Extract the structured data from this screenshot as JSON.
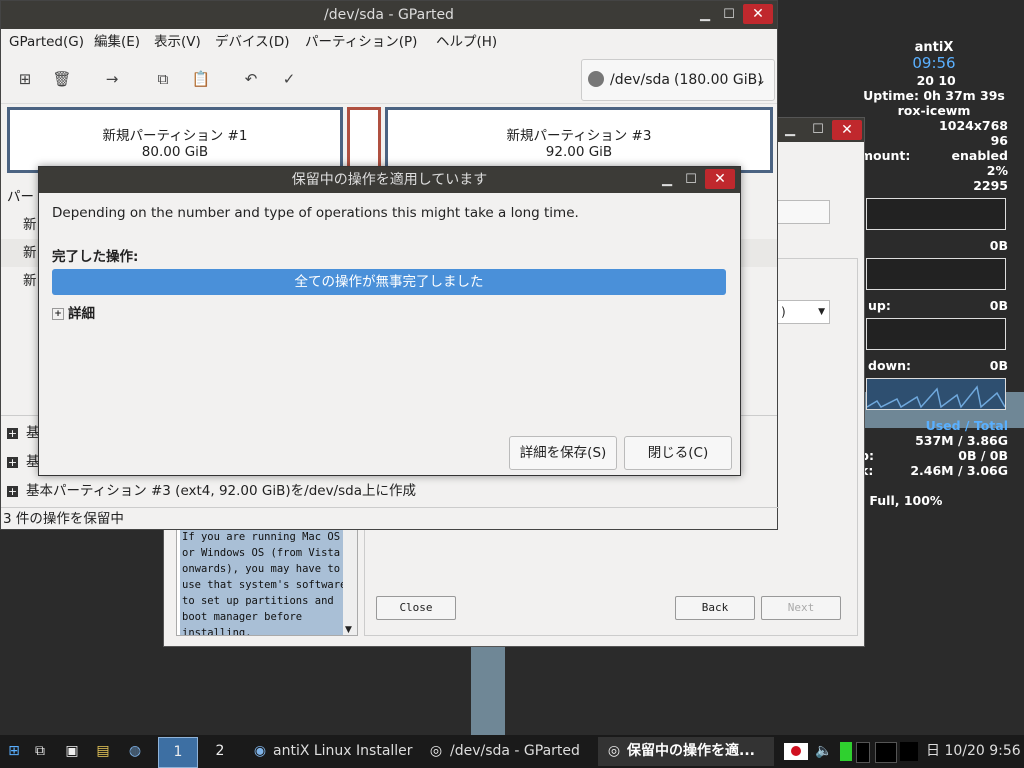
{
  "conky": {
    "hostname": "antiX",
    "time": "09:56",
    "date": "  20 10 ",
    "uptime": "Uptime: 0h 37m 39s",
    "wm": "rox-icewm",
    "resolution": "1024x768",
    "val96": "96",
    "automount_label": "mount:",
    "automount_value": "enabled",
    "cpu_value": "2%",
    "mhz_value": "2295",
    "sep1": ":",
    "sep2": ":",
    "disk_value": "0B",
    "up_label": "up:",
    "up_value": "0B",
    "down_label": "down:",
    "down_value": "0B",
    "used_total": "Used / Total",
    "ram_label": ":",
    "ram_value": "537M / 3.86G",
    "swap_label": "p:",
    "swap_value": "0B / 0B",
    "disk2_label": "k:",
    "disk2_value": "2.46M / 3.06G",
    "battery": ": Full, 100%"
  },
  "installer": {
    "help_text": "If you are running Mac OS\nor Windows OS (from Vista\nonwards), you may have to\nuse that system's software\nto set up partitions and\nboot manager before\ninstalling.",
    "close_label": "Close",
    "back_label": "Back",
    "next_label": "Next",
    "combo_value": ")"
  },
  "gparted": {
    "title": "/dev/sda - GParted",
    "menu": [
      "GParted(G)",
      "編集(E)",
      "表示(V)",
      "デバイス(D)",
      "パーティション(P)",
      "ヘルプ(H)"
    ],
    "device": "/dev/sda",
    "device_size": "(180.00 GiB)",
    "partitions": [
      {
        "name": "新規パーティション #1",
        "size": "80.00 GiB"
      },
      {
        "name": "新規パーティション #3",
        "size": "92.00 GiB"
      }
    ],
    "list_header": "パー",
    "list_rows": [
      "新",
      "新",
      "新"
    ],
    "ops": [
      "基",
      "基",
      "基本パーティション #3 (ext4, 92.00 GiB)を/dev/sda上に作成"
    ],
    "status": "3 件の操作を保留中"
  },
  "dialog": {
    "title": "保留中の操作を適用しています",
    "description": "Depending on the number and type of operations this might take a long time.",
    "completed_label": "完了した操作:",
    "progress_text": "全ての操作が無事完了しました",
    "progress": 1.0,
    "details_label": "詳細",
    "save_button": "詳細を保存(S)",
    "close_button": "閉じる(C)"
  },
  "taskbar": {
    "workspace1": "1",
    "workspace2": "2",
    "tasks": [
      "antiX Linux Installer",
      "/dev/sda - GParted",
      "保留中の操作を適..."
    ],
    "clock": "日 10/20  9:56"
  },
  "colors": {
    "accent": "#4a90d9",
    "titlebar": "#3c3b37",
    "close": "#c0282d",
    "conky_blue": "#5ab0ff"
  }
}
